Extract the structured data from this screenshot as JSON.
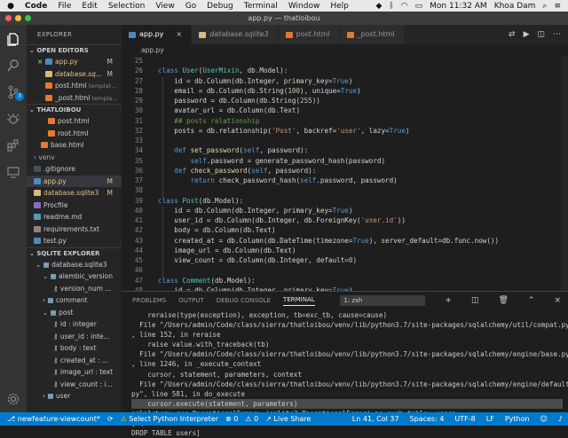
{
  "menubar": {
    "app": "Code",
    "items": [
      "File",
      "Edit",
      "Selection",
      "View",
      "Go",
      "Debug",
      "Terminal",
      "Window",
      "Help"
    ],
    "clock": "Mon 11:32 AM",
    "user": "Khoa Dam"
  },
  "window": {
    "title": "app.py — thatloibou"
  },
  "sidebar": {
    "header": "EXPLORER",
    "open_editors_title": "OPEN EDITORS",
    "open_editors": [
      {
        "icon": "×",
        "name": "app.py",
        "badge": "M",
        "color": "#e2c08d",
        "fi": "#4b8bbe"
      },
      {
        "icon": "",
        "name": "database.sq...",
        "badge": "M",
        "color": "#e2c08d",
        "fi": "#d7ba7d",
        "italic": true
      },
      {
        "icon": "",
        "name": "post.html",
        "sub": "templat...",
        "color": "#ccc",
        "fi": "#e37933"
      },
      {
        "icon": "",
        "name": "_post.html",
        "sub": "templa...",
        "color": "#ccc",
        "fi": "#e37933"
      }
    ],
    "project_title": "THATLOIBOU",
    "files": [
      {
        "name": "post.html",
        "indent": 20,
        "color": "#ccc",
        "fi": "#e37933"
      },
      {
        "name": "root.html",
        "indent": 20,
        "color": "#ccc",
        "fi": "#e37933"
      },
      {
        "name": "base.html",
        "indent": 12,
        "color": "#ccc",
        "fi": "#e37933"
      },
      {
        "name": "venv",
        "indent": 4,
        "color": "#aaa",
        "chev": "›"
      },
      {
        "name": ".gitignore",
        "indent": 4,
        "color": "#ccc",
        "fi": "#41535b"
      },
      {
        "name": "app.py",
        "indent": 4,
        "color": "#e2c08d",
        "fi": "#4b8bbe",
        "badge": "M",
        "sel": true
      },
      {
        "name": "database.sqlite3",
        "indent": 4,
        "color": "#e2c08d",
        "fi": "#d7ba7d",
        "badge": "M"
      },
      {
        "name": "Procfile",
        "indent": 4,
        "color": "#ccc",
        "fi": "#8a6bbf"
      },
      {
        "name": "readme.md",
        "indent": 4,
        "color": "#ccc",
        "fi": "#519aba"
      },
      {
        "name": "requirements.txt",
        "indent": 4,
        "color": "#ccc",
        "fi": "#888"
      },
      {
        "name": "test.py",
        "indent": 4,
        "color": "#ccc",
        "fi": "#4b8bbe"
      }
    ],
    "sqlite_title": "SQLITE EXPLORER",
    "sqlite": [
      {
        "name": "database.sqlite3",
        "indent": 10,
        "chev": "⌄"
      },
      {
        "name": "alembic_version",
        "indent": 18,
        "chev": "⌄"
      },
      {
        "name": "version_num ...",
        "indent": 30,
        "key": true
      },
      {
        "name": "comment",
        "indent": 18,
        "chev": "›"
      },
      {
        "name": "post",
        "indent": 18,
        "chev": "⌄"
      },
      {
        "name": "id : integer",
        "indent": 30,
        "key": true
      },
      {
        "name": "user_id : inte...",
        "indent": 30,
        "key": true
      },
      {
        "name": "body : text",
        "indent": 30,
        "key": true
      },
      {
        "name": "created_at : ...",
        "indent": 30,
        "key": true
      },
      {
        "name": "image_url : text",
        "indent": 30,
        "key": true
      },
      {
        "name": "view_count : i...",
        "indent": 30,
        "key": true
      },
      {
        "name": "user",
        "indent": 18,
        "chev": "›"
      }
    ]
  },
  "tabs": [
    {
      "name": "app.py",
      "active": true,
      "fi": "#4b8bbe",
      "close": "×"
    },
    {
      "name": "database.sqlite3",
      "active": false,
      "fi": "#d7ba7d",
      "italic": true
    },
    {
      "name": "post.html",
      "active": false,
      "fi": "#e37933"
    },
    {
      "name": "_post.html",
      "active": false,
      "fi": "#e37933"
    }
  ],
  "breadcrumb": "app.py",
  "editor": {
    "first_line": 25,
    "lines": [
      [
        [
          "",
          ""
        ]
      ],
      [
        [
          "kw",
          "class "
        ],
        [
          "cls",
          "User"
        ],
        [
          "",
          "("
        ],
        [
          "cls",
          "UserMixin"
        ],
        [
          "",
          ", db.Model):"
        ]
      ],
      [
        [
          "",
          "    id = db.Column(db.Integer, primary_key="
        ],
        [
          "kw",
          "True"
        ],
        [
          "",
          ")"
        ]
      ],
      [
        [
          "",
          "    email = db.Column(db.String("
        ],
        [
          "num",
          "100"
        ],
        [
          "",
          "), unique="
        ],
        [
          "kw",
          "True"
        ],
        [
          "",
          ")"
        ]
      ],
      [
        [
          "",
          "    password = db.Column(db.String("
        ],
        [
          "num",
          "255"
        ],
        [
          "",
          "))"
        ]
      ],
      [
        [
          "",
          "    avatar_url = db.Column(db.Text)"
        ]
      ],
      [
        [
          "cm",
          "    ## posts relationship"
        ]
      ],
      [
        [
          "",
          "    posts = db.relationship("
        ],
        [
          "str",
          "'Post'"
        ],
        [
          "",
          ", backref="
        ],
        [
          "str",
          "'user'"
        ],
        [
          "",
          ", lazy="
        ],
        [
          "kw",
          "True"
        ],
        [
          "",
          ")"
        ]
      ],
      [
        [
          "",
          ""
        ]
      ],
      [
        [
          "kw",
          "    def "
        ],
        [
          "fn",
          "set_password"
        ],
        [
          "",
          "("
        ],
        [
          "slf",
          "self"
        ],
        [
          "",
          ", password):"
        ]
      ],
      [
        [
          "slf",
          "        self"
        ],
        [
          "",
          ".password = generate_password_hash(password)"
        ]
      ],
      [
        [
          "kw",
          "    def "
        ],
        [
          "fn",
          "check_password"
        ],
        [
          "",
          "("
        ],
        [
          "slf",
          "self"
        ],
        [
          "",
          ", password):"
        ]
      ],
      [
        [
          "kw",
          "        return "
        ],
        [
          "",
          "check_password_hash("
        ],
        [
          "slf",
          "self"
        ],
        [
          "",
          ".password, password)"
        ]
      ],
      [
        [
          "",
          ""
        ]
      ],
      [
        [
          "kw",
          "class "
        ],
        [
          "cls",
          "Post"
        ],
        [
          "",
          "(db.Model):"
        ]
      ],
      [
        [
          "",
          "    id = db.Column(db.Integer, primary_key="
        ],
        [
          "kw",
          "True"
        ],
        [
          "",
          ")"
        ]
      ],
      [
        [
          "",
          "    user_id = db.Column(db.Integer, db.ForeignKey("
        ],
        [
          "str",
          "'user.id'"
        ],
        [
          "",
          "))"
        ]
      ],
      [
        [
          "",
          "    body = db.Column(db.Text)"
        ]
      ],
      [
        [
          "",
          "    created_at = db.Column(db.DateTime(timezone="
        ],
        [
          "kw",
          "True"
        ],
        [
          "",
          "), server_default=db.func.now())"
        ]
      ],
      [
        [
          "",
          "    image_url = db.Column(db.Text)"
        ]
      ],
      [
        [
          "",
          "    view_count = db.Column(db.Integer, default="
        ],
        [
          "num",
          "0"
        ],
        [
          "",
          ")"
        ]
      ],
      [
        [
          "",
          ""
        ]
      ],
      [
        [
          "kw",
          "class "
        ],
        [
          "cls",
          "Comment"
        ],
        [
          "",
          "(db.Model):"
        ]
      ],
      [
        [
          "",
          "    id = db.Column(db.Integer, primary_key="
        ],
        [
          "kw",
          "True"
        ],
        [
          "",
          ")"
        ]
      ]
    ]
  },
  "panel": {
    "tabs": [
      "PROBLEMS",
      "OUTPUT",
      "DEBUG CONSOLE",
      "TERMINAL"
    ],
    "active": "TERMINAL",
    "shell": "1: zsh",
    "terminal": [
      "    reraise(type(exception), exception, tb=exc_tb, cause=cause)",
      "  File \"/Users/admin/Code/class/sierra/thatloibou/venv/lib/python3.7/site-packages/sqlalchemy/util/compat.py\"",
      ", line 152, in reraise",
      "    raise value.with_traceback(tb)",
      "  File \"/Users/admin/Code/class/sierra/thatloibou/venv/lib/python3.7/site-packages/sqlalchemy/engine/base.py\"",
      ", line 1246, in _execute_context",
      "    cursor, statement, parameters, context",
      "  File \"/Users/admin/Code/class/sierra/thatloibou/venv/lib/python3.7/site-packages/sqlalchemy/engine/default.",
      "py\", line 581, in do_execute",
      "    cursor.execute(statement, parameters)",
      "sqlalchemy.exc.OperationalError: (sqlite3.OperationalError) no such table: users",
      "[SQL:",
      "DROP TABLE users]"
    ],
    "highlight_line": 9
  },
  "status": {
    "branch": "newfeature-viewcount*",
    "sync": "⟳",
    "interpreter": "Select Python Interpreter",
    "errors": "⊗ 0",
    "warnings": "⚠ 0",
    "liveshare": "Live Share",
    "position": "Ln 41, Col 37",
    "spaces": "Spaces: 4",
    "encoding": "UTF-8",
    "eol": "LF",
    "language": "Python"
  }
}
